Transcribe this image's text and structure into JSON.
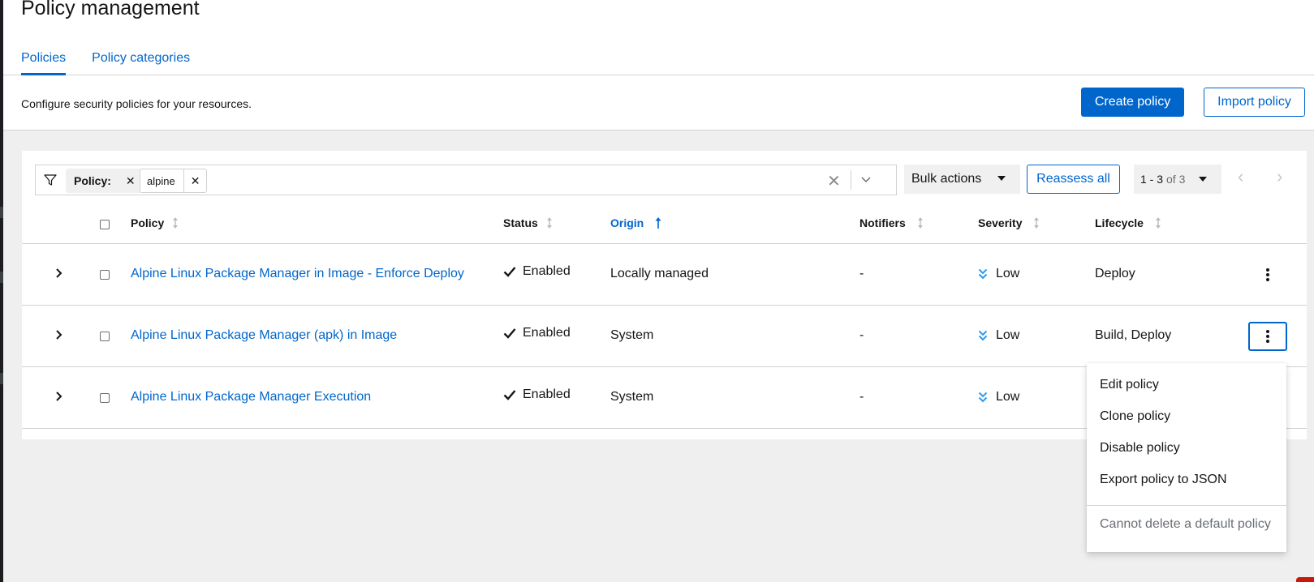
{
  "page": {
    "title": "Policy management",
    "tabs": [
      {
        "label": "Policies",
        "active": true
      },
      {
        "label": "Policy categories",
        "active": false
      }
    ]
  },
  "toolbar": {
    "description": "Configure security policies for your resources.",
    "create_label": "Create policy",
    "import_label": "Import policy"
  },
  "filter": {
    "chip_label": "Policy:",
    "chip_value": "alpine",
    "bulk_actions_label": "Bulk actions",
    "reassess_label": "Reassess all",
    "pagination_range": "1 - 3",
    "pagination_total": "of 3"
  },
  "table": {
    "columns": [
      "Policy",
      "Status",
      "Origin",
      "Notifiers",
      "Severity",
      "Lifecycle"
    ],
    "rows": [
      {
        "policy": "Alpine Linux Package Manager in Image - Enforce Deploy",
        "status": "Enabled",
        "origin": "Locally managed",
        "notifiers": "-",
        "severity": "Low",
        "lifecycle": "Deploy"
      },
      {
        "policy": "Alpine Linux Package Manager (apk) in Image",
        "status": "Enabled",
        "origin": "System",
        "notifiers": "-",
        "severity": "Low",
        "lifecycle": "Build, Deploy"
      },
      {
        "policy": "Alpine Linux Package Manager Execution",
        "status": "Enabled",
        "origin": "System",
        "notifiers": "-",
        "severity": "Low",
        "lifecycle": ""
      }
    ]
  },
  "menu": {
    "items": [
      "Edit policy",
      "Clone policy",
      "Disable policy",
      "Export policy to JSON"
    ],
    "disabled_item": "Cannot delete a default policy"
  },
  "colors": {
    "link_blue": "#0066cc",
    "severity_blue": "#2b9af3",
    "disabled_grey": "#6a6e73"
  }
}
